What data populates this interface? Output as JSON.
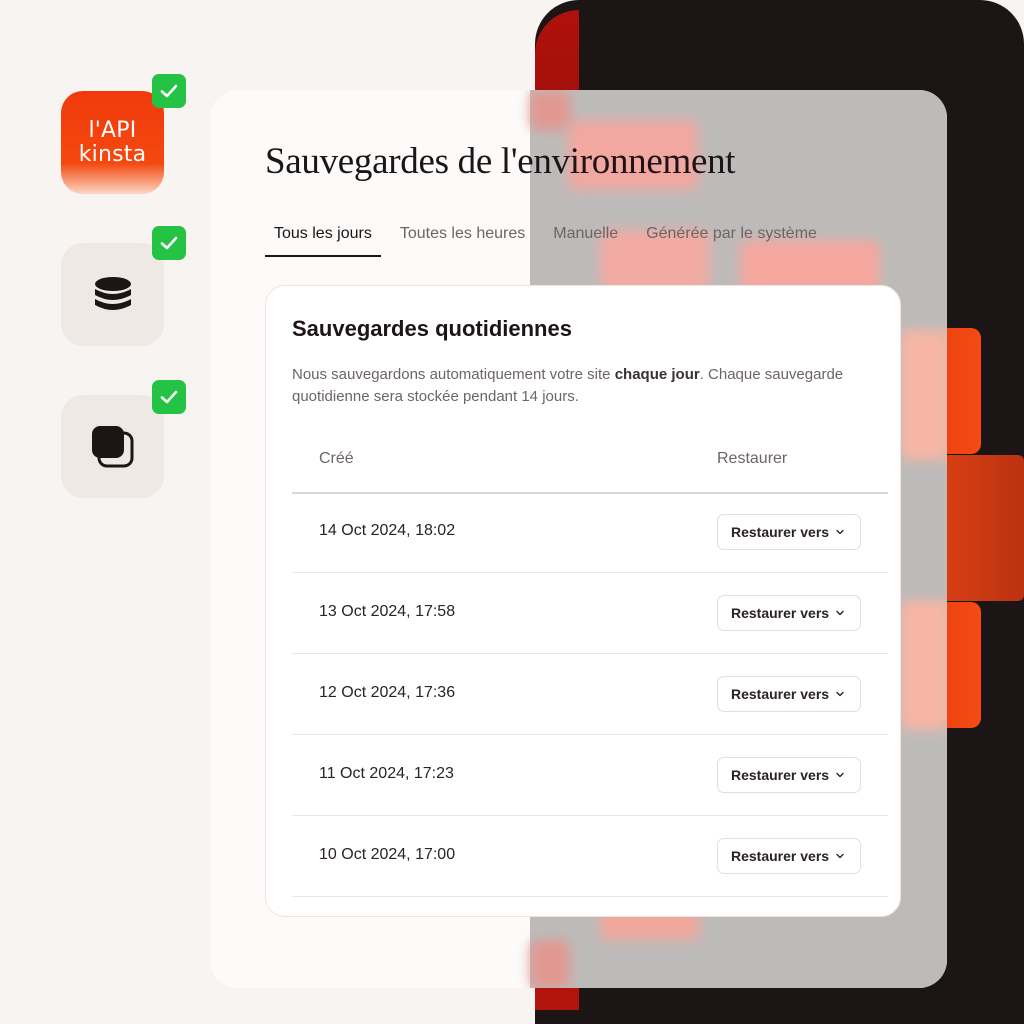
{
  "sidebar": {
    "apps": [
      {
        "name": "api",
        "label": "l'API\nkinsta",
        "check": "checkmark-icon"
      },
      {
        "name": "database",
        "icon": "database-icon",
        "check": "checkmark-icon"
      },
      {
        "name": "copy",
        "icon": "stacked-squares-icon",
        "check": "checkmark-icon"
      }
    ],
    "api_line1": "l'API",
    "api_line2": "kinsta"
  },
  "page": {
    "title": "Sauvegardes de l'environnement"
  },
  "tabs": [
    {
      "label": "Tous les jours",
      "active": true
    },
    {
      "label": "Toutes les heures",
      "active": false
    },
    {
      "label": "Manuelle",
      "active": false
    },
    {
      "label": "Générée par le système",
      "active": false
    }
  ],
  "panel": {
    "title": "Sauvegardes quotidiennes",
    "desc_before": "Nous sauvegardons automatiquement votre site ",
    "desc_bold": "chaque jour",
    "desc_after": ". Chaque sauvegarde quotidienne sera stockée pendant 14 jours.",
    "col_created": "Créé",
    "col_restore": "Restaurer",
    "rows": [
      {
        "date": "14 Oct 2024, 18:02",
        "action": "Restaurer vers"
      },
      {
        "date": "13 Oct 2024, 17:58",
        "action": "Restaurer vers"
      },
      {
        "date": "12 Oct 2024, 17:36",
        "action": "Restaurer vers"
      },
      {
        "date": "11 Oct 2024, 17:23",
        "action": "Restaurer vers"
      },
      {
        "date": "10 Oct 2024, 17:00",
        "action": "Restaurer vers"
      }
    ]
  },
  "colors": {
    "brand": "#f13a0c",
    "check": "#24c343",
    "text": "#1c1416",
    "muted": "#6d6466"
  }
}
